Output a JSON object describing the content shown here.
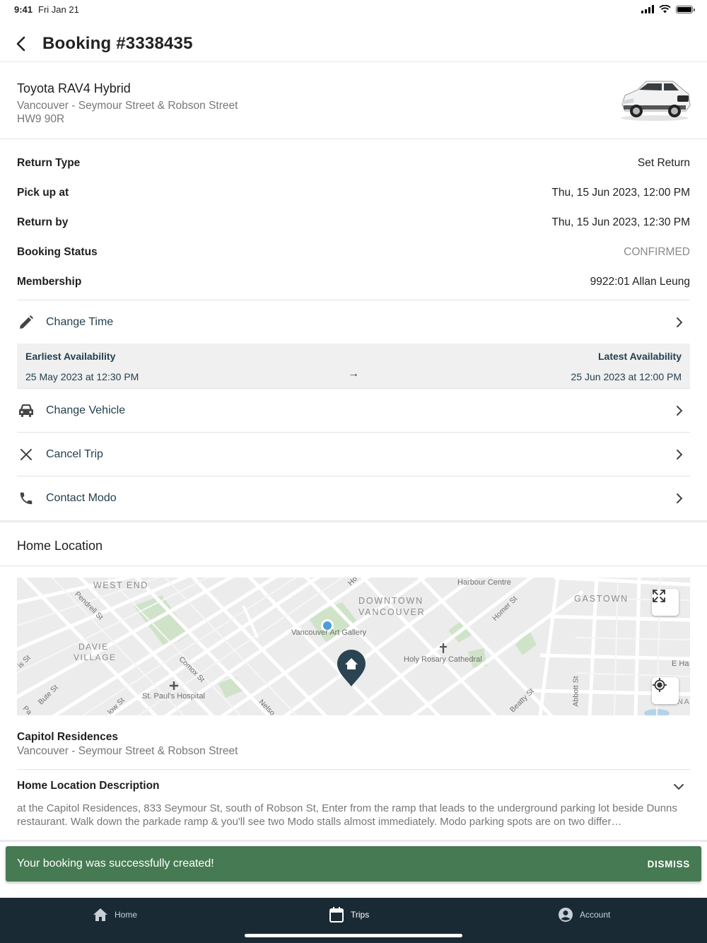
{
  "status_bar": {
    "time": "9:41",
    "date": "Fri Jan 21"
  },
  "header": {
    "title": "Booking #3338435"
  },
  "vehicle": {
    "name": "Toyota RAV4 Hybrid",
    "location": "Vancouver - Seymour Street & Robson Street",
    "plate": "HW9 90R"
  },
  "details": [
    {
      "label": "Return Type",
      "value": "Set Return"
    },
    {
      "label": "Pick up at",
      "value": "Thu, 15 Jun 2023, 12:00 PM"
    },
    {
      "label": "Return by",
      "value": "Thu, 15 Jun 2023, 12:30 PM"
    },
    {
      "label": "Booking Status",
      "value": "CONFIRMED"
    },
    {
      "label": "Membership",
      "value": "9922:01 Allan Leung"
    }
  ],
  "actions": {
    "change_time": "Change Time",
    "change_vehicle": "Change Vehicle",
    "cancel_trip": "Cancel Trip",
    "contact": "Contact Modo"
  },
  "availability": {
    "earliest_label": "Earliest Availability",
    "earliest_value": "25 May 2023 at 12:30 PM",
    "arrow": "→",
    "latest_label": "Latest Availability",
    "latest_value": "25 Jun 2023 at 12:00 PM"
  },
  "home_location": {
    "heading": "Home Location",
    "map_labels": {
      "west_end": "WEST END",
      "downtown_1": "DOWNTOWN",
      "downtown_2": "VANCOUVER",
      "gastown": "GASTOWN",
      "davie_1": "DAVIE",
      "davie_2": "VILLAGE",
      "art_gallery": "Vancouver Art Gallery",
      "harbour": "Harbour Centre",
      "holy_rosary": "Holy Rosary Cathedral",
      "st_pauls": "St. Paul's Hospital",
      "pendrell": "Pendrell St",
      "comox": "Comox St",
      "homer": "Homer St",
      "beatty": "Beatty St",
      "abbott": "Abbott St",
      "bute": "Bute St",
      "nelson": "Nelso",
      "e_ha": "E Ha",
      "ho": "Ho",
      "is_st": "is St",
      "low_st": "low St",
      "pa": "Pa",
      "na": "NA"
    },
    "name": "Capitol Residences",
    "address": "Vancouver - Seymour Street & Robson Street",
    "description_title": "Home Location Description",
    "description": "at the Capitol Residences, 833 Seymour St, south of Robson St, Enter from the ramp that leads to the underground parking lot beside Dunns restaurant.  Walk down the parkade ramp & you'll see two Modo stalls almost immediately.  Modo parking spots are on two differ…"
  },
  "snackbar": {
    "message": "Your booking was successfully created!",
    "action": "DISMISS"
  },
  "tabs": {
    "home": "Home",
    "trips": "Trips",
    "account": "Account"
  },
  "colors": {
    "accent": "#24404f",
    "snackbar": "#467a52",
    "tabbar": "#1a2a35",
    "pin": "#2a4452"
  }
}
